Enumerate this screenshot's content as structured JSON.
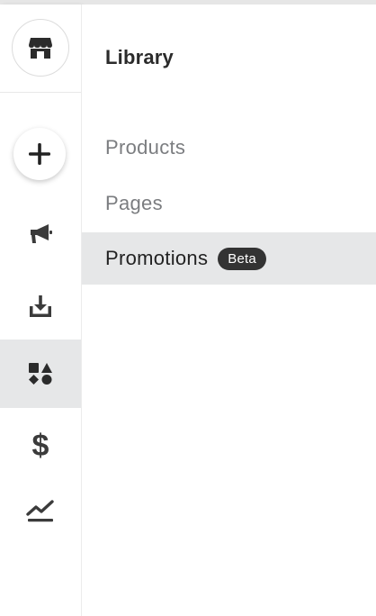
{
  "rail": {
    "icons": {
      "store": "store-icon",
      "add": "plus-icon",
      "promote": "megaphone-icon",
      "download": "download-icon",
      "library": "shapes-icon",
      "sales": "dollar-icon",
      "analytics": "trend-chart-icon"
    },
    "active_item": "library"
  },
  "subnav": {
    "title": "Library",
    "items": [
      {
        "label": "Products",
        "active": false
      },
      {
        "label": "Pages",
        "active": false
      },
      {
        "label": "Promotions",
        "active": true,
        "badge": "Beta"
      }
    ]
  },
  "colors": {
    "active_background": "#e6e7e8",
    "badge_background": "#333333",
    "inactive_text": "#7b7d80",
    "active_text": "#222222"
  }
}
